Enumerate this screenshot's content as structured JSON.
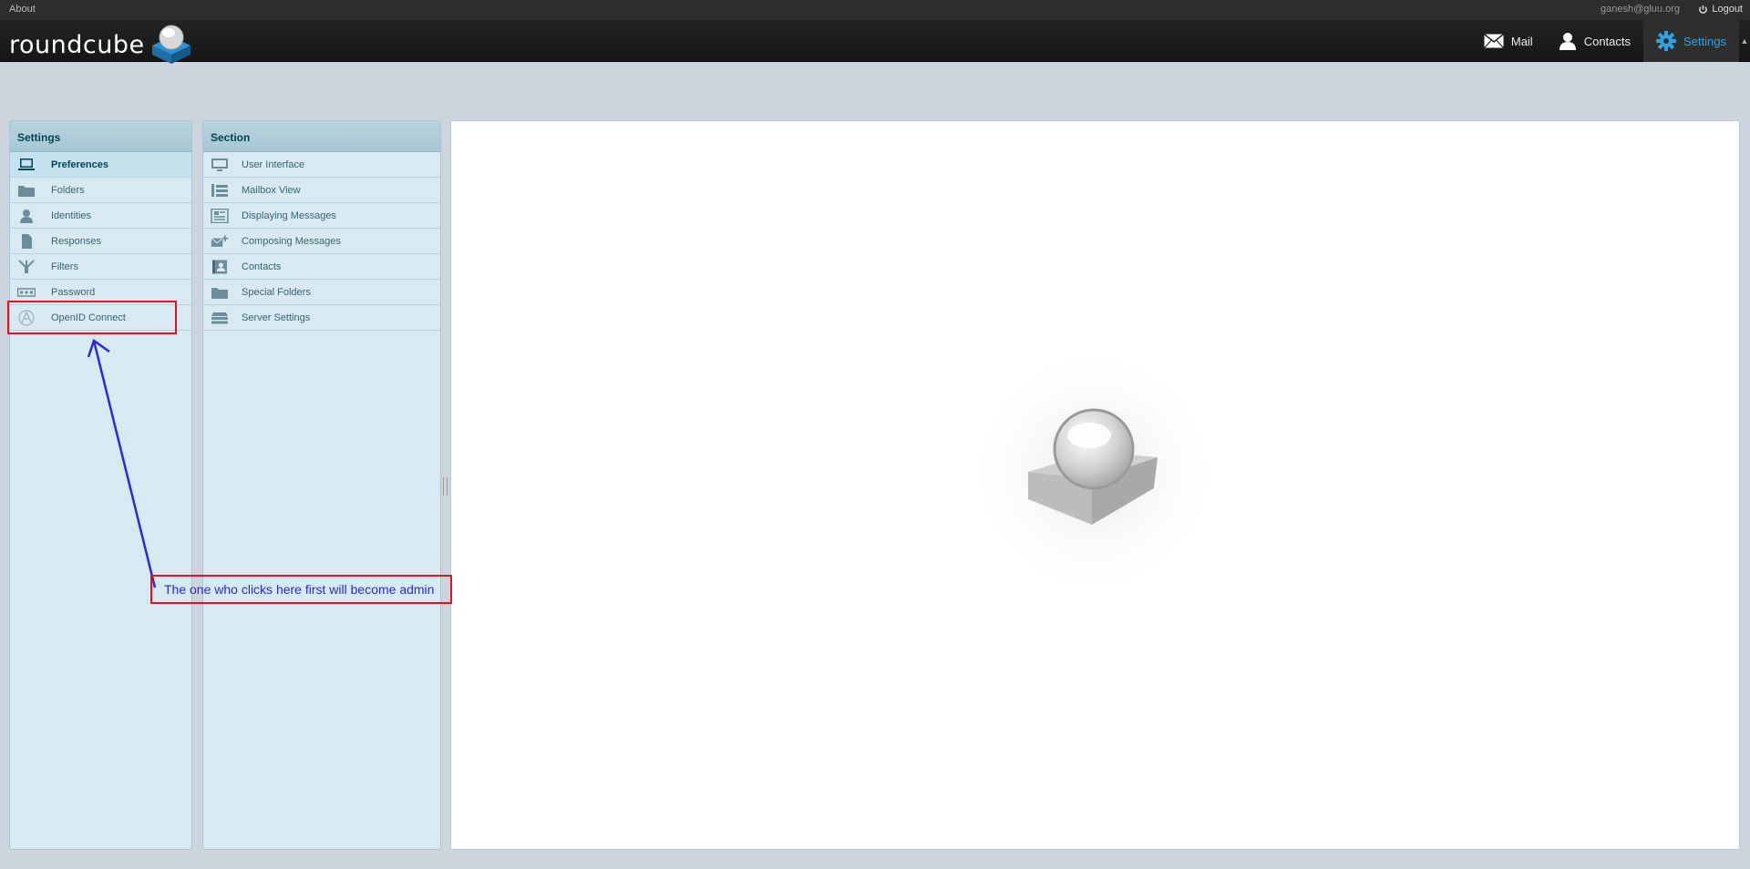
{
  "topbar": {
    "about": "About",
    "user_email": "ganesh@gluu.org",
    "logout": "Logout"
  },
  "header": {
    "logo_text": "roundcube",
    "nav": [
      {
        "label": "Mail",
        "icon": "envelope-icon"
      },
      {
        "label": "Contacts",
        "icon": "person-icon"
      },
      {
        "label": "Settings",
        "icon": "gear-icon",
        "active": true
      }
    ]
  },
  "settings_panel": {
    "title": "Settings",
    "items": [
      {
        "label": "Preferences",
        "icon": "laptop-icon",
        "selected": true
      },
      {
        "label": "Folders",
        "icon": "folder-icon"
      },
      {
        "label": "Identities",
        "icon": "person-icon"
      },
      {
        "label": "Responses",
        "icon": "document-icon"
      },
      {
        "label": "Filters",
        "icon": "filter-icon"
      },
      {
        "label": "Password",
        "icon": "password-icon"
      },
      {
        "label": "OpenID Connect",
        "icon": "openid-icon"
      }
    ]
  },
  "section_panel": {
    "title": "Section",
    "items": [
      {
        "label": "User Interface",
        "icon": "monitor-icon"
      },
      {
        "label": "Mailbox View",
        "icon": "list-icon"
      },
      {
        "label": "Displaying Messages",
        "icon": "message-icon"
      },
      {
        "label": "Composing Messages",
        "icon": "compose-icon"
      },
      {
        "label": "Contacts",
        "icon": "contact-card-icon"
      },
      {
        "label": "Special Folders",
        "icon": "folder-icon"
      },
      {
        "label": "Server Settings",
        "icon": "server-icon"
      }
    ]
  },
  "annotation": {
    "text": "The one who clicks here first will become admin",
    "color": "#2a2ad6",
    "box_color": "#e8101f"
  },
  "colors": {
    "accent": "#2fa3e2",
    "panel_bg": "#d8e9f1",
    "panel_header": "#004458"
  }
}
